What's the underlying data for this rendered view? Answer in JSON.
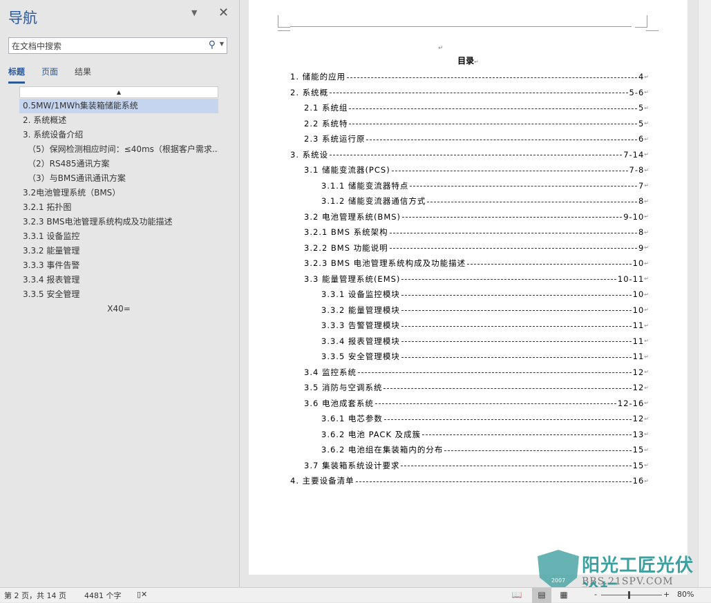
{
  "nav": {
    "title": "导航",
    "search_placeholder": "在文档中搜索",
    "tabs": [
      "标题",
      "页面",
      "结果"
    ],
    "headings": [
      {
        "text": "0.5MW/1MWh集装箱储能系统",
        "level": 1,
        "selected": true
      },
      {
        "text": "2. 系统概述",
        "level": 1
      },
      {
        "text": "3. 系统设备介绍",
        "level": 1
      },
      {
        "text": "（5）保网检测相应时间：≤40ms（根据客户需求...",
        "level": 2
      },
      {
        "text": "（2）RS485通讯方案",
        "level": 2
      },
      {
        "text": "（3）与BMS通讯通讯方案",
        "level": 2
      },
      {
        "text": "3.2电池管理系统（BMS）",
        "level": 1
      },
      {
        "text": "3.2.1 拓扑图",
        "level": 1
      },
      {
        "text": "3.2.3 BMS电池管理系统构成及功能描述",
        "level": 1
      },
      {
        "text": "3.3.1 设备监控",
        "level": 1
      },
      {
        "text": "3.3.2 能量管理",
        "level": 1
      },
      {
        "text": "3.3.3 事件告警",
        "level": 1
      },
      {
        "text": "3.3.4 报表管理",
        "level": 1
      },
      {
        "text": "3.3.5 安全管理",
        "level": 1
      },
      {
        "text": "X40=",
        "level": 0
      }
    ]
  },
  "document": {
    "toc_title": "目录",
    "entries": [
      {
        "text": "1. 储能的应用",
        "page": "4",
        "level": 1
      },
      {
        "text": "2. 系统概",
        "page": "5-6",
        "level": 1
      },
      {
        "text": "2.1  系统组",
        "page": "5",
        "level": 2
      },
      {
        "text": "2.2  系统特",
        "page": "5",
        "level": 2
      },
      {
        "text": "2.3  系统运行原",
        "page": "6",
        "level": 2
      },
      {
        "text": "3. 系统设",
        "page": "7-14",
        "level": 1
      },
      {
        "text": "3.1  储能变流器(PCS) ",
        "page": "7-8",
        "level": 2
      },
      {
        "text": "3.1.1  储能变流器特点",
        "page": "7",
        "level": 3
      },
      {
        "text": "3.1.2  储能变流器通信方式",
        "page": "8",
        "level": 3
      },
      {
        "text": "3.2  电池管理系统(BMS)",
        "page": "9-10",
        "level": 2
      },
      {
        "text": "3.2.1  BMS 系统架构 ",
        "page": "8",
        "level": 2
      },
      {
        "text": "3.2.2  BMS 功能说明 ",
        "page": "9",
        "level": 2
      },
      {
        "text": "3.2.3  BMS 电池管理系统构成及功能描述 ",
        "page": "10",
        "level": 2
      },
      {
        "text": "3.3  能量管理系统(EMS) ",
        "page": "10-11",
        "level": 2
      },
      {
        "text": "3.3.1  设备监控模块",
        "page": "10",
        "level": 3
      },
      {
        "text": "3.3.2  能量管理模块",
        "page": "10",
        "level": 3
      },
      {
        "text": "3.3.3  告警管理模块",
        "page": "11",
        "level": 3
      },
      {
        "text": "3.3.4  报表管理模块",
        "page": "11",
        "level": 3
      },
      {
        "text": "3.3.5  安全管理模块",
        "page": "11",
        "level": 3
      },
      {
        "text": "3.4  监控系统",
        "page": "12",
        "level": 2
      },
      {
        "text": "3.5  消防与空调系统",
        "page": "12",
        "level": 2
      },
      {
        "text": "3.6  电池成套系统",
        "page": "12-16",
        "level": 2
      },
      {
        "text": "3.6.1  电芯参数",
        "page": "12",
        "level": 3
      },
      {
        "text": "3.6.2  电池 PACK 及成簇 ",
        "page": "13",
        "level": 3
      },
      {
        "text": "3.6.2  电池组在集装箱内的分布",
        "page": "15",
        "level": 3
      },
      {
        "text": "3.7  集装箱系统设计要求",
        "page": "15",
        "level": 2
      },
      {
        "text": "4.  主要设备清单 ",
        "page": "16",
        "level": 1
      }
    ]
  },
  "status": {
    "page": "第 2 页，共 14 页",
    "words": "4481 个字",
    "zoom": "80%"
  },
  "watermark": {
    "name": "阳光工匠光伏论坛",
    "url": "BBS.21SPV.COM",
    "year": "2007"
  },
  "colors": {
    "accent": "#2b579a",
    "selected": "#c5d5ef"
  }
}
